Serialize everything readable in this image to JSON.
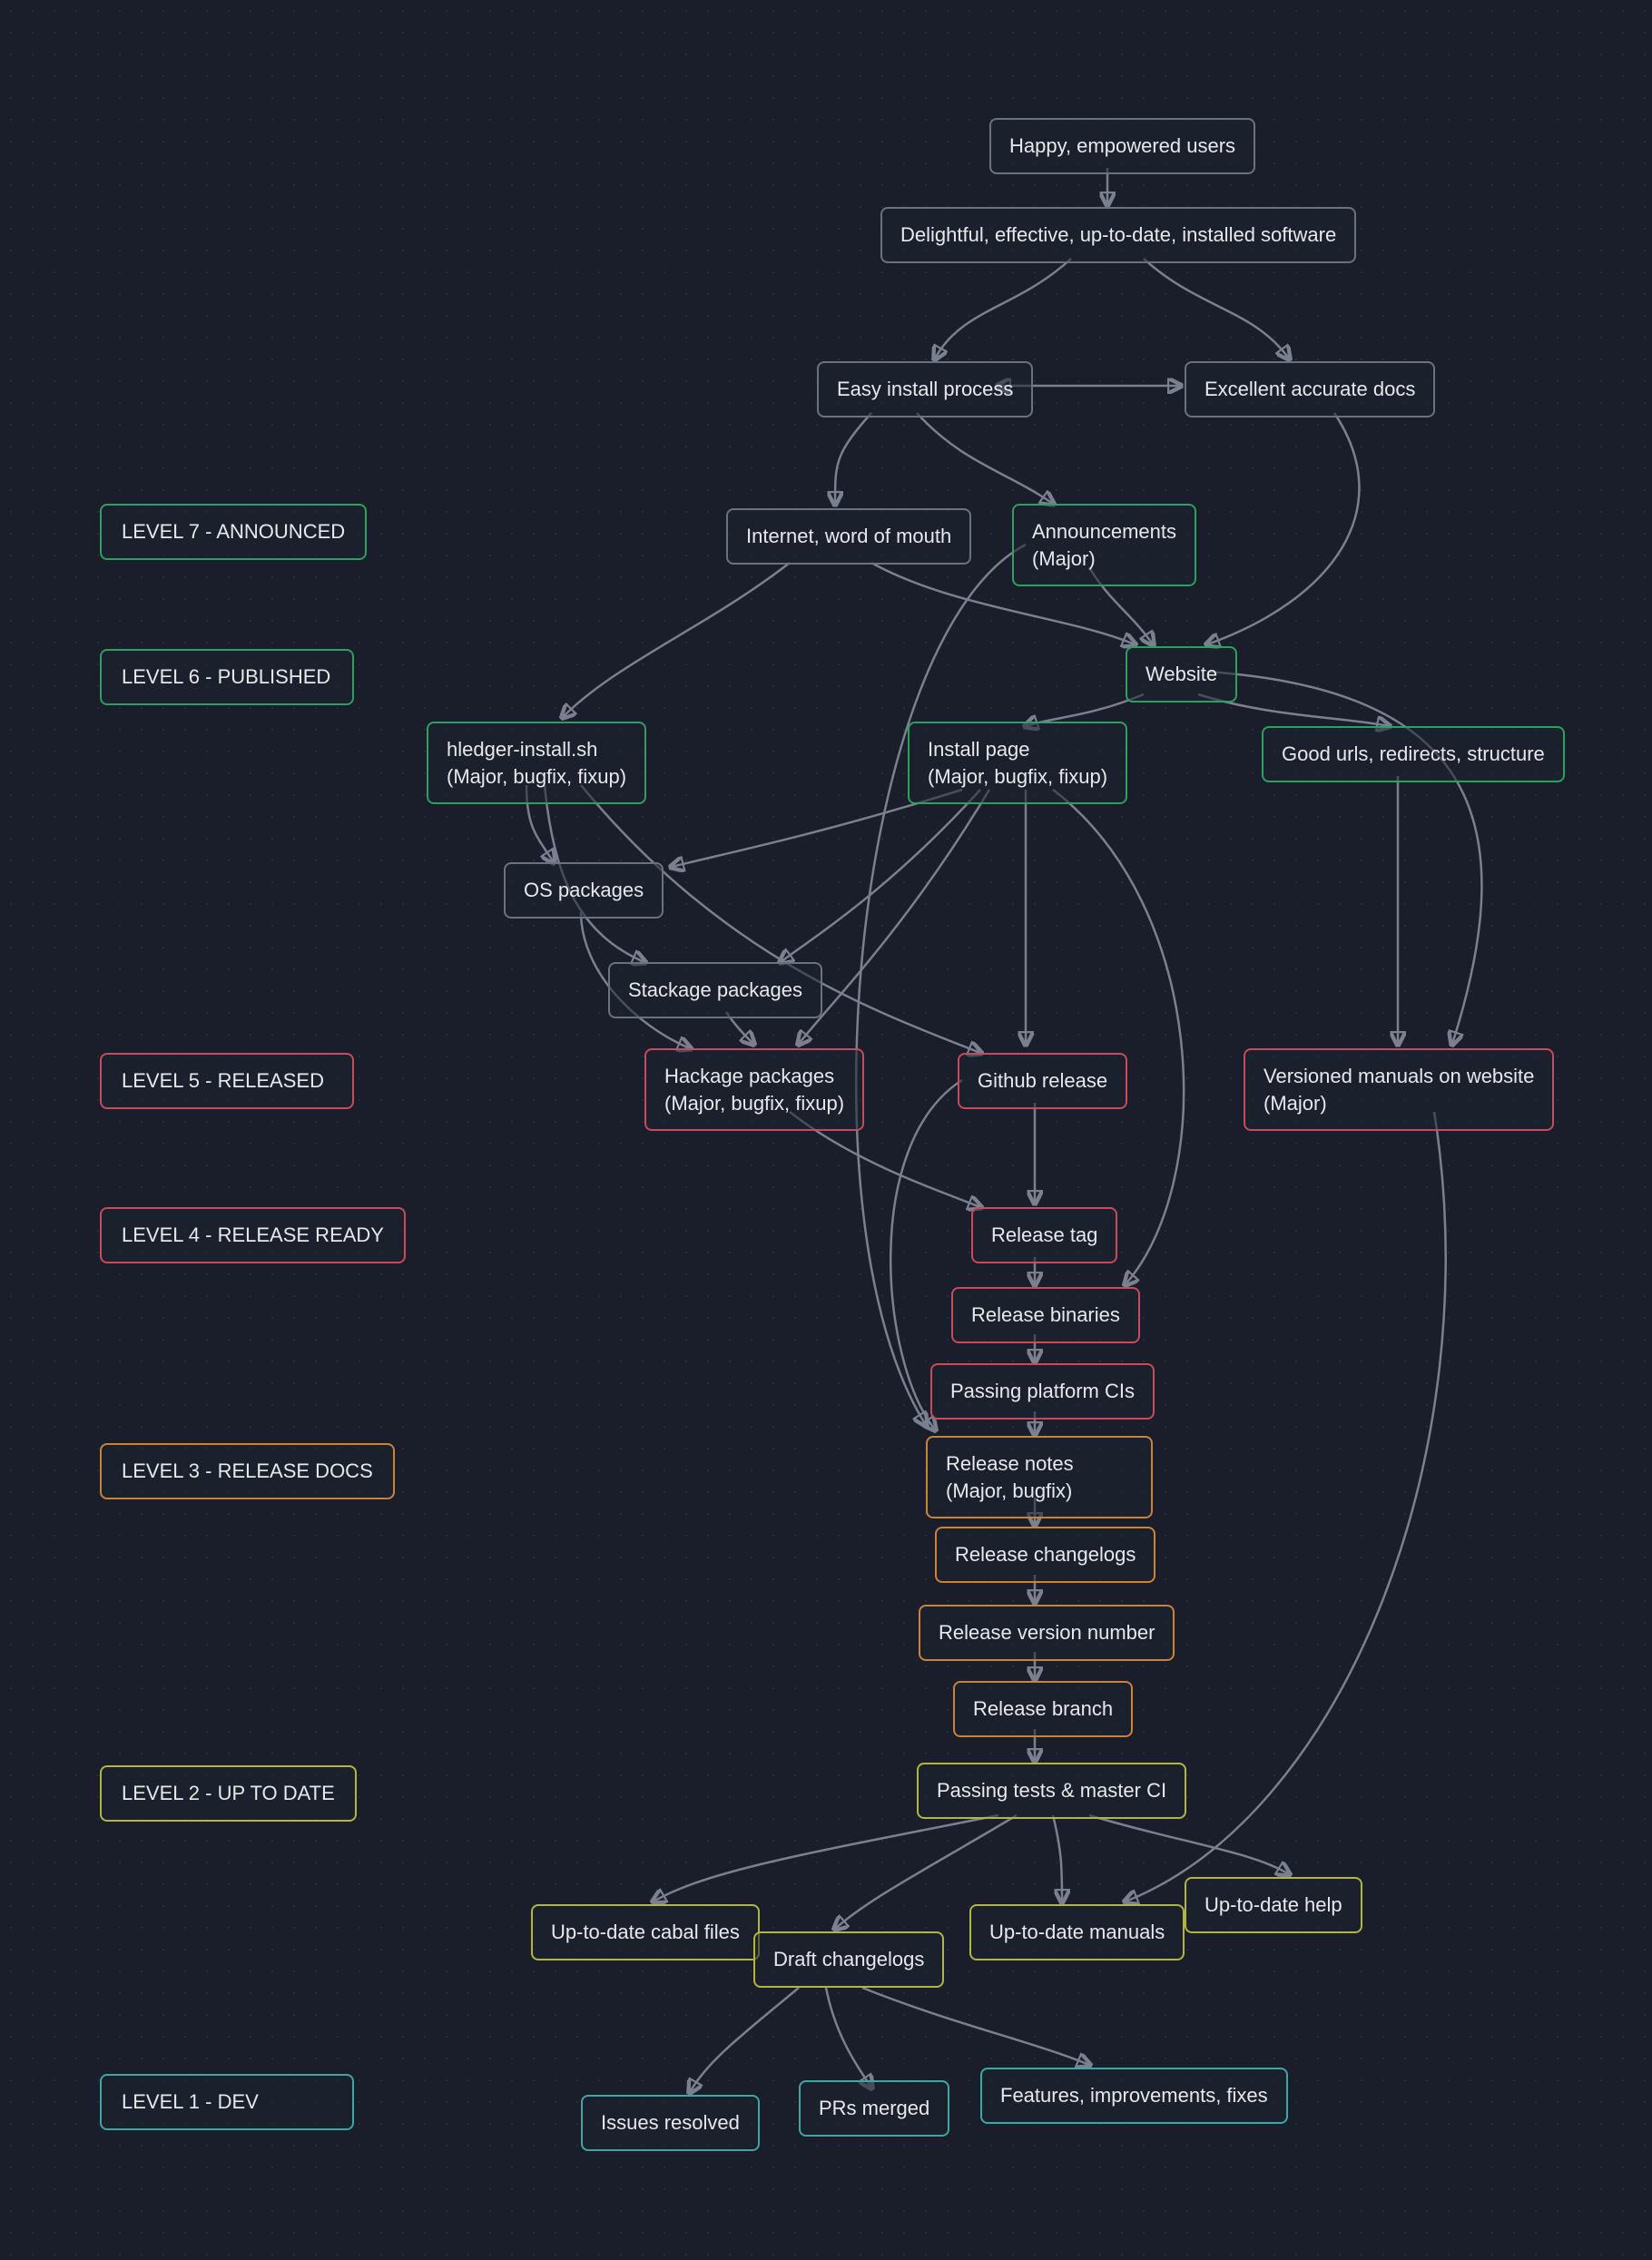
{
  "levels": {
    "l7": "LEVEL 7 - ANNOUNCED",
    "l6": "LEVEL 6 - PUBLISHED",
    "l5": "LEVEL 5 - RELEASED",
    "l4": "LEVEL 4 - RELEASE READY",
    "l3": "LEVEL 3 - RELEASE DOCS",
    "l2": "LEVEL 2 - UP TO DATE",
    "l1": "LEVEL 1 - DEV"
  },
  "nodes": {
    "happy": "Happy, empowered users",
    "delightful": "Delightful, effective, up-to-date, installed software",
    "easy_install": "Easy install process",
    "excellent_docs": "Excellent accurate docs",
    "internet": "Internet, word of mouth",
    "announcements": "Announcements\n(Major)",
    "website": "Website",
    "hledger_install": "hledger-install.sh\n(Major, bugfix, fixup)",
    "install_page": "Install page\n(Major, bugfix, fixup)",
    "good_urls": "Good urls, redirects, structure",
    "os_packages": "OS packages",
    "stackage": "Stackage packages",
    "hackage": "Hackage packages\n(Major, bugfix, fixup)",
    "github_release": "Github release",
    "versioned_manuals": "Versioned manuals on website\n(Major)",
    "release_tag": "Release tag",
    "release_binaries": "Release binaries",
    "passing_platform": "Passing platform CIs",
    "release_notes": "Release notes\n(Major, bugfix)",
    "release_changelogs": "Release changelogs",
    "release_version": "Release version number",
    "release_branch": "Release branch",
    "passing_tests": "Passing tests & master CI",
    "cabal_files": "Up-to-date cabal files",
    "draft_changelogs": "Draft changelogs",
    "uptodate_manuals": "Up-to-date manuals",
    "uptodate_help": "Up-to-date help",
    "issues_resolved": "Issues resolved",
    "prs_merged": "PRs merged",
    "features": "Features, improvements, fixes"
  }
}
